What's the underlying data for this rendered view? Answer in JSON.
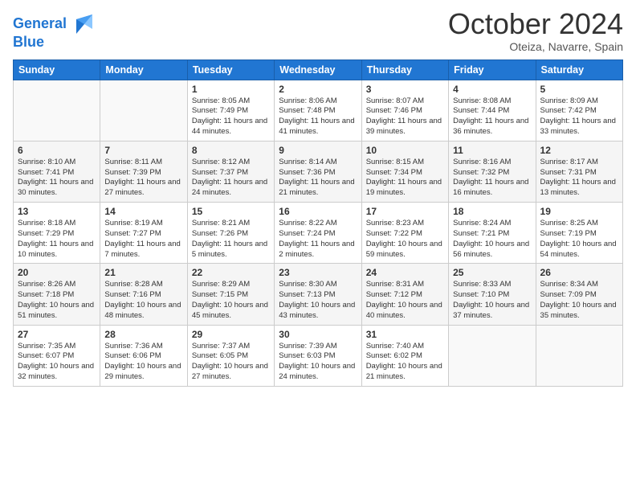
{
  "header": {
    "logo_line1": "General",
    "logo_line2": "Blue",
    "month": "October 2024",
    "location": "Oteiza, Navarre, Spain"
  },
  "days_of_week": [
    "Sunday",
    "Monday",
    "Tuesday",
    "Wednesday",
    "Thursday",
    "Friday",
    "Saturday"
  ],
  "weeks": [
    [
      {
        "num": "",
        "sunrise": "",
        "sunset": "",
        "daylight": ""
      },
      {
        "num": "",
        "sunrise": "",
        "sunset": "",
        "daylight": ""
      },
      {
        "num": "1",
        "sunrise": "Sunrise: 8:05 AM",
        "sunset": "Sunset: 7:49 PM",
        "daylight": "Daylight: 11 hours and 44 minutes."
      },
      {
        "num": "2",
        "sunrise": "Sunrise: 8:06 AM",
        "sunset": "Sunset: 7:48 PM",
        "daylight": "Daylight: 11 hours and 41 minutes."
      },
      {
        "num": "3",
        "sunrise": "Sunrise: 8:07 AM",
        "sunset": "Sunset: 7:46 PM",
        "daylight": "Daylight: 11 hours and 39 minutes."
      },
      {
        "num": "4",
        "sunrise": "Sunrise: 8:08 AM",
        "sunset": "Sunset: 7:44 PM",
        "daylight": "Daylight: 11 hours and 36 minutes."
      },
      {
        "num": "5",
        "sunrise": "Sunrise: 8:09 AM",
        "sunset": "Sunset: 7:42 PM",
        "daylight": "Daylight: 11 hours and 33 minutes."
      }
    ],
    [
      {
        "num": "6",
        "sunrise": "Sunrise: 8:10 AM",
        "sunset": "Sunset: 7:41 PM",
        "daylight": "Daylight: 11 hours and 30 minutes."
      },
      {
        "num": "7",
        "sunrise": "Sunrise: 8:11 AM",
        "sunset": "Sunset: 7:39 PM",
        "daylight": "Daylight: 11 hours and 27 minutes."
      },
      {
        "num": "8",
        "sunrise": "Sunrise: 8:12 AM",
        "sunset": "Sunset: 7:37 PM",
        "daylight": "Daylight: 11 hours and 24 minutes."
      },
      {
        "num": "9",
        "sunrise": "Sunrise: 8:14 AM",
        "sunset": "Sunset: 7:36 PM",
        "daylight": "Daylight: 11 hours and 21 minutes."
      },
      {
        "num": "10",
        "sunrise": "Sunrise: 8:15 AM",
        "sunset": "Sunset: 7:34 PM",
        "daylight": "Daylight: 11 hours and 19 minutes."
      },
      {
        "num": "11",
        "sunrise": "Sunrise: 8:16 AM",
        "sunset": "Sunset: 7:32 PM",
        "daylight": "Daylight: 11 hours and 16 minutes."
      },
      {
        "num": "12",
        "sunrise": "Sunrise: 8:17 AM",
        "sunset": "Sunset: 7:31 PM",
        "daylight": "Daylight: 11 hours and 13 minutes."
      }
    ],
    [
      {
        "num": "13",
        "sunrise": "Sunrise: 8:18 AM",
        "sunset": "Sunset: 7:29 PM",
        "daylight": "Daylight: 11 hours and 10 minutes."
      },
      {
        "num": "14",
        "sunrise": "Sunrise: 8:19 AM",
        "sunset": "Sunset: 7:27 PM",
        "daylight": "Daylight: 11 hours and 7 minutes."
      },
      {
        "num": "15",
        "sunrise": "Sunrise: 8:21 AM",
        "sunset": "Sunset: 7:26 PM",
        "daylight": "Daylight: 11 hours and 5 minutes."
      },
      {
        "num": "16",
        "sunrise": "Sunrise: 8:22 AM",
        "sunset": "Sunset: 7:24 PM",
        "daylight": "Daylight: 11 hours and 2 minutes."
      },
      {
        "num": "17",
        "sunrise": "Sunrise: 8:23 AM",
        "sunset": "Sunset: 7:22 PM",
        "daylight": "Daylight: 10 hours and 59 minutes."
      },
      {
        "num": "18",
        "sunrise": "Sunrise: 8:24 AM",
        "sunset": "Sunset: 7:21 PM",
        "daylight": "Daylight: 10 hours and 56 minutes."
      },
      {
        "num": "19",
        "sunrise": "Sunrise: 8:25 AM",
        "sunset": "Sunset: 7:19 PM",
        "daylight": "Daylight: 10 hours and 54 minutes."
      }
    ],
    [
      {
        "num": "20",
        "sunrise": "Sunrise: 8:26 AM",
        "sunset": "Sunset: 7:18 PM",
        "daylight": "Daylight: 10 hours and 51 minutes."
      },
      {
        "num": "21",
        "sunrise": "Sunrise: 8:28 AM",
        "sunset": "Sunset: 7:16 PM",
        "daylight": "Daylight: 10 hours and 48 minutes."
      },
      {
        "num": "22",
        "sunrise": "Sunrise: 8:29 AM",
        "sunset": "Sunset: 7:15 PM",
        "daylight": "Daylight: 10 hours and 45 minutes."
      },
      {
        "num": "23",
        "sunrise": "Sunrise: 8:30 AM",
        "sunset": "Sunset: 7:13 PM",
        "daylight": "Daylight: 10 hours and 43 minutes."
      },
      {
        "num": "24",
        "sunrise": "Sunrise: 8:31 AM",
        "sunset": "Sunset: 7:12 PM",
        "daylight": "Daylight: 10 hours and 40 minutes."
      },
      {
        "num": "25",
        "sunrise": "Sunrise: 8:33 AM",
        "sunset": "Sunset: 7:10 PM",
        "daylight": "Daylight: 10 hours and 37 minutes."
      },
      {
        "num": "26",
        "sunrise": "Sunrise: 8:34 AM",
        "sunset": "Sunset: 7:09 PM",
        "daylight": "Daylight: 10 hours and 35 minutes."
      }
    ],
    [
      {
        "num": "27",
        "sunrise": "Sunrise: 7:35 AM",
        "sunset": "Sunset: 6:07 PM",
        "daylight": "Daylight: 10 hours and 32 minutes."
      },
      {
        "num": "28",
        "sunrise": "Sunrise: 7:36 AM",
        "sunset": "Sunset: 6:06 PM",
        "daylight": "Daylight: 10 hours and 29 minutes."
      },
      {
        "num": "29",
        "sunrise": "Sunrise: 7:37 AM",
        "sunset": "Sunset: 6:05 PM",
        "daylight": "Daylight: 10 hours and 27 minutes."
      },
      {
        "num": "30",
        "sunrise": "Sunrise: 7:39 AM",
        "sunset": "Sunset: 6:03 PM",
        "daylight": "Daylight: 10 hours and 24 minutes."
      },
      {
        "num": "31",
        "sunrise": "Sunrise: 7:40 AM",
        "sunset": "Sunset: 6:02 PM",
        "daylight": "Daylight: 10 hours and 21 minutes."
      },
      {
        "num": "",
        "sunrise": "",
        "sunset": "",
        "daylight": ""
      },
      {
        "num": "",
        "sunrise": "",
        "sunset": "",
        "daylight": ""
      }
    ]
  ]
}
